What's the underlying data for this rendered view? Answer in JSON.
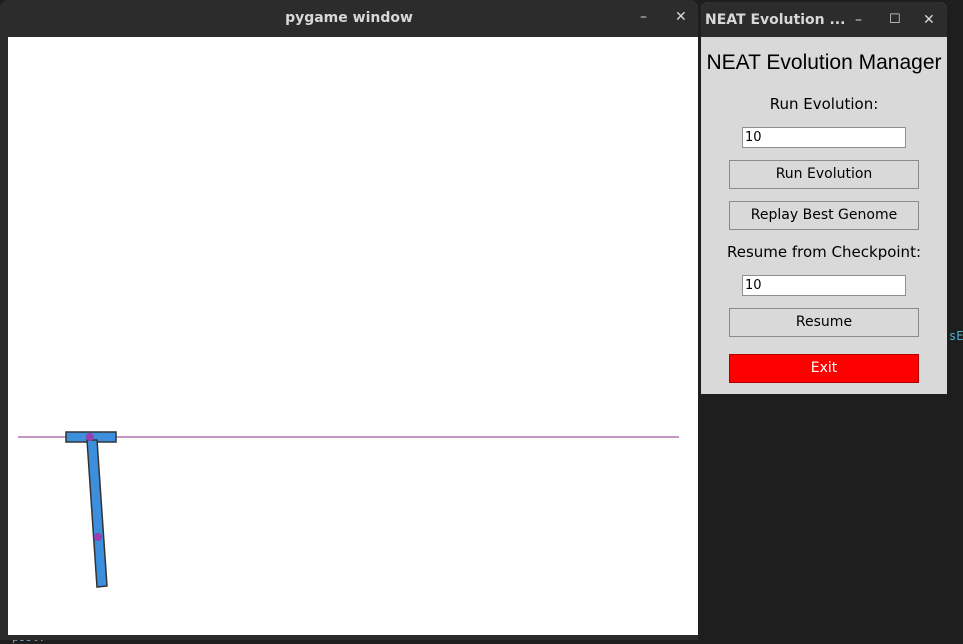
{
  "pygame_window": {
    "title": "pygame window",
    "minimize_glyph": "–",
    "close_glyph": "✕"
  },
  "neat_window": {
    "title": "NEAT Evolution ...",
    "minimize_glyph": "–",
    "maximize_glyph": "☐",
    "close_glyph": "✕",
    "heading": "NEAT Evolution Manager",
    "run_label": "Run Evolution:",
    "run_generations_value": "10",
    "run_button": "Run Evolution",
    "replay_button": "Replay Best Genome",
    "resume_label": "Resume from Checkpoint:",
    "resume_checkpoint_value": "10",
    "resume_button": "Resume",
    "exit_button": "Exit"
  },
  "background_editor": {
    "right_fragment": "sE",
    "bottom_fragment": "pool:"
  },
  "colors": {
    "ground_line": "#8b2f8b",
    "body_fill": "#3c8fdd",
    "joint": "#9b3fae",
    "exit_button": "#ff0000"
  }
}
